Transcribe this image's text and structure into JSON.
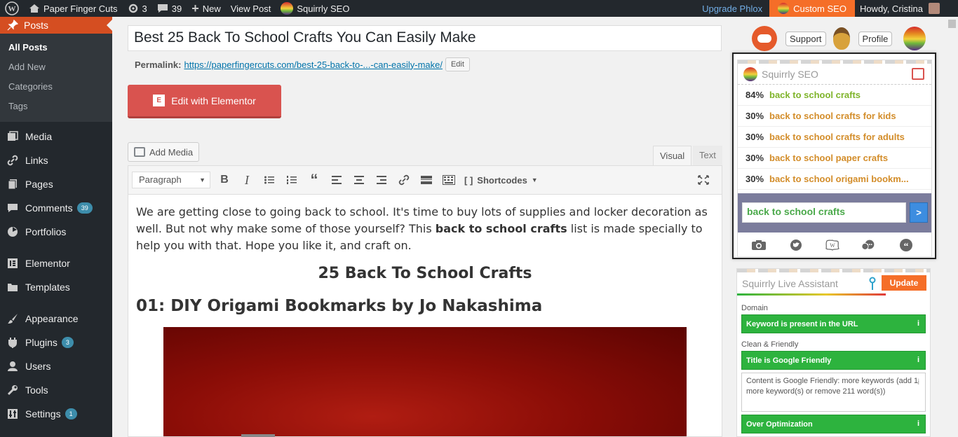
{
  "adminbar": {
    "site_name": "Paper Finger Cuts",
    "updates_count": "3",
    "comments_count": "39",
    "new_label": "New",
    "view_post_label": "View Post",
    "squirrly_label": "Squirrly SEO",
    "upgrade_label": "Upgrade Phlox",
    "custom_seo_label": "Custom SEO",
    "howdy_label": "Howdy, Cristina"
  },
  "sidebar": {
    "posts_label": "Posts",
    "submenu": [
      "All Posts",
      "Add New",
      "Categories",
      "Tags"
    ],
    "items": [
      {
        "label": "Media",
        "icon": "media-icon"
      },
      {
        "label": "Links",
        "icon": "link-icon"
      },
      {
        "label": "Pages",
        "icon": "pages-icon"
      },
      {
        "label": "Comments",
        "icon": "comments-icon",
        "count": "39"
      },
      {
        "label": "Portfolios",
        "icon": "portfolio-icon"
      },
      {
        "label": "Elementor",
        "icon": "elementor-icon"
      },
      {
        "label": "Templates",
        "icon": "folder-icon"
      },
      {
        "label": "Appearance",
        "icon": "brush-icon"
      },
      {
        "label": "Plugins",
        "icon": "plugin-icon",
        "count": "3"
      },
      {
        "label": "Users",
        "icon": "user-icon"
      },
      {
        "label": "Tools",
        "icon": "wrench-icon"
      },
      {
        "label": "Settings",
        "icon": "settings-icon",
        "count": "1"
      }
    ]
  },
  "editor": {
    "title_value": "Best 25 Back To School Crafts You Can Easily Make",
    "permalink_label": "Permalink:",
    "permalink_url": "https://paperfingercuts.com/best-25-back-to-...-can-easily-make/",
    "edit_label": "Edit",
    "elementor_label": "Edit with Elementor",
    "add_media_label": "Add Media",
    "tab_visual": "Visual",
    "tab_text": "Text",
    "format_select": "Paragraph",
    "shortcodes_label": "Shortcodes",
    "content": {
      "intro_1": "We are getting close to going back to school. It's time to buy lots of supplies and locker decoration as well. But not why make some of those yourself? This ",
      "intro_bold": "back to school crafts",
      "intro_2": " list is made specially to help you with that. Hope you like it, and craft on.",
      "heading": "25 Back To School Crafts",
      "subheading": "01: DIY Origami Bookmarks by Jo Nakashima"
    }
  },
  "squirrly": {
    "support_label": "Support",
    "profile_label": "Profile",
    "panel_title": "Squirrly SEO",
    "keywords": [
      {
        "pct": "84%",
        "keyword": "back to school crafts"
      },
      {
        "pct": "30%",
        "keyword": "back to school crafts for kids"
      },
      {
        "pct": "30%",
        "keyword": "back to school crafts for adults"
      },
      {
        "pct": "30%",
        "keyword": "back to school paper crafts"
      },
      {
        "pct": "30%",
        "keyword": "back to school origami bookm..."
      }
    ],
    "search_value": "back to school crafts",
    "go_label": ">",
    "live_title": "Squirrly Live Assistant",
    "update_label": "Update",
    "domain_label": "Domain",
    "check_url": "Keyword is present in the URL",
    "clean_label": "Clean & Friendly",
    "check_title": "Title is Google Friendly",
    "check_content": "Content is Google Friendly: more keywords (add 1 more keyword(s) or remove 211 word(s))",
    "check_over": "Over Optimization",
    "info_glyph": "i"
  },
  "colors": {
    "accent_orange": "#f56e28",
    "admin_dark": "#23282d",
    "green_check": "#2db33e",
    "elementor_red": "#d9534f"
  }
}
